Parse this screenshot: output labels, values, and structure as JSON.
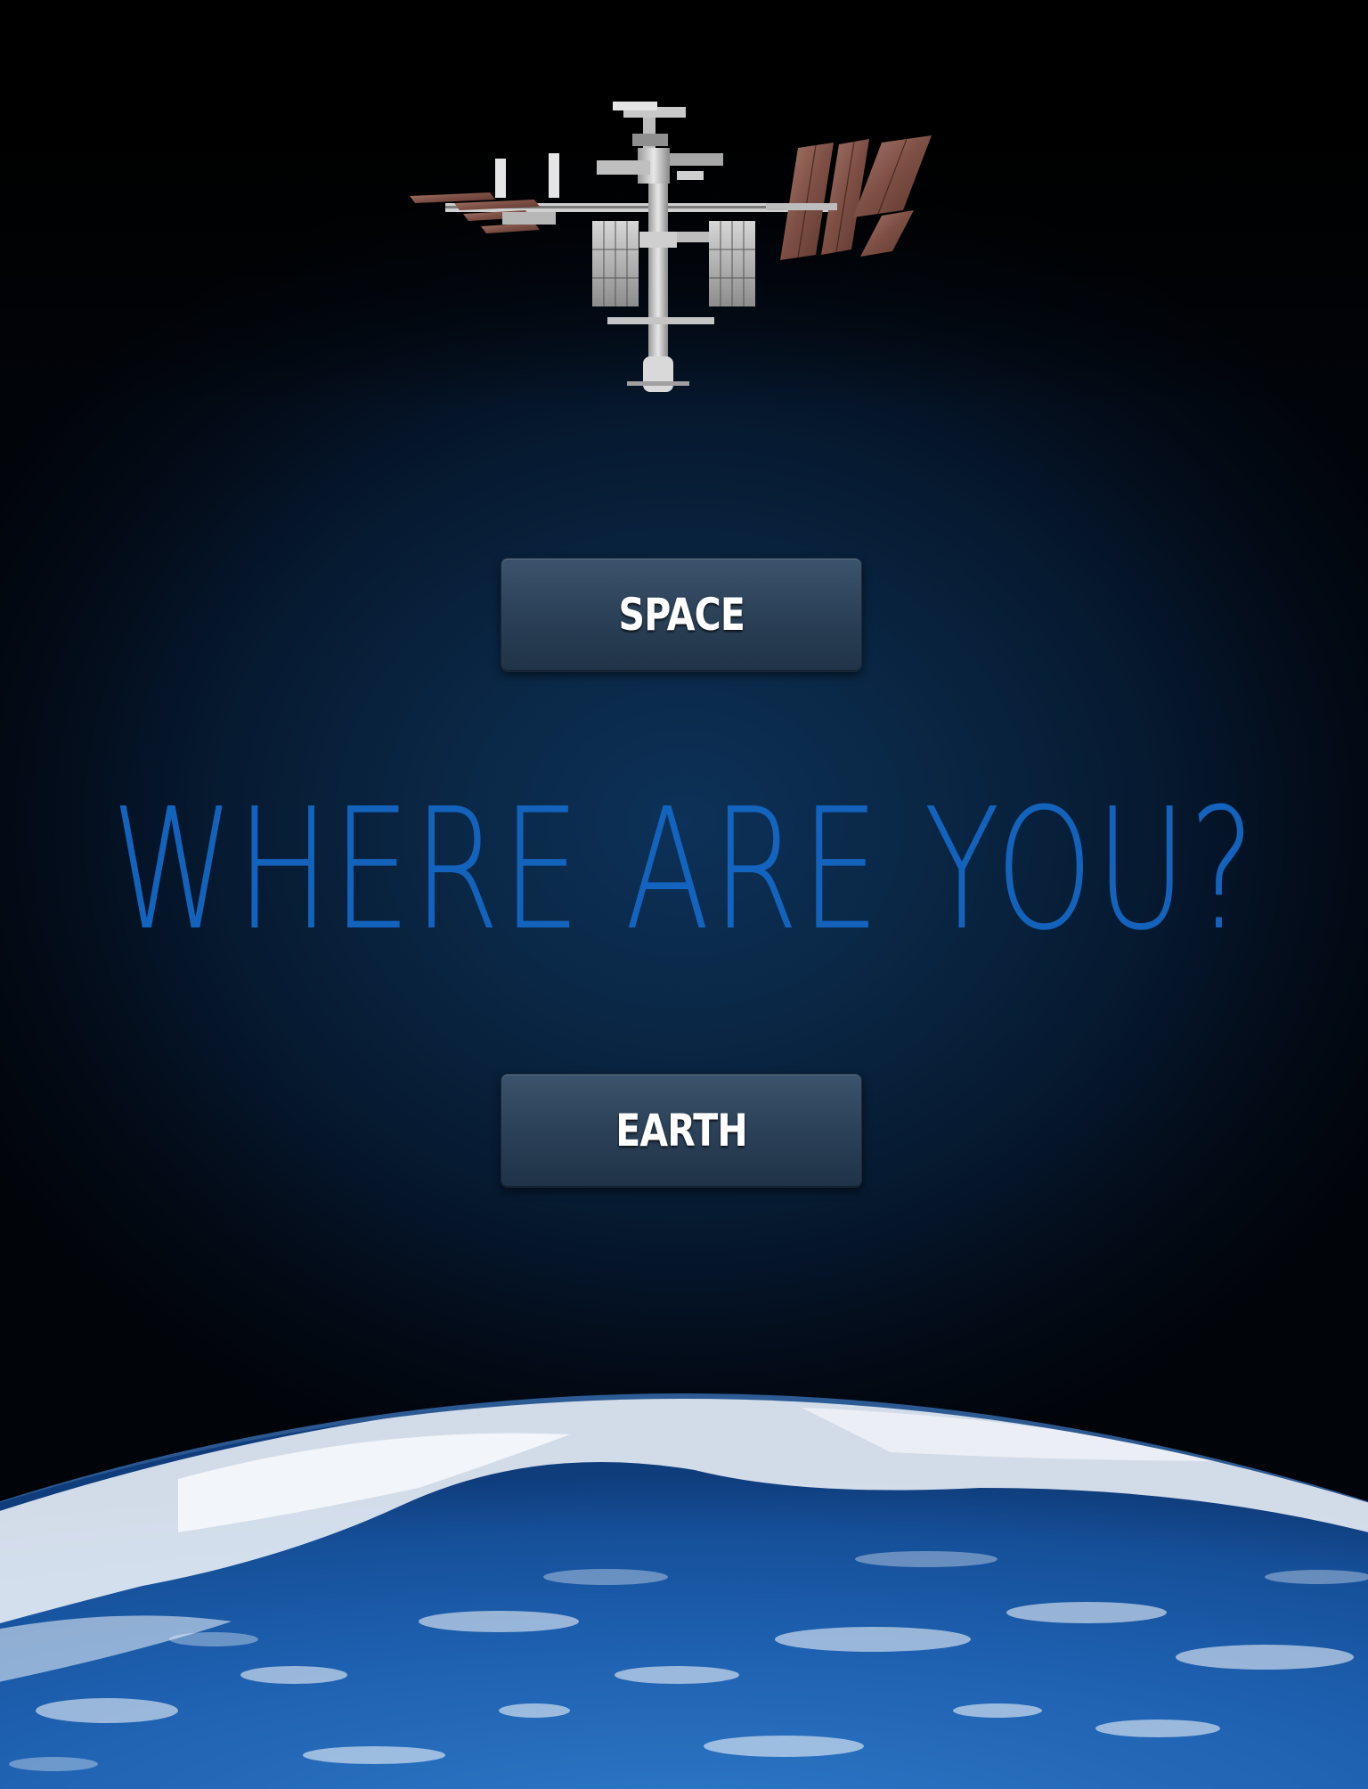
{
  "screen": {
    "headline": "WHERE ARE YOU?",
    "buttons": {
      "space_label": "SPACE",
      "earth_label": "EARTH"
    }
  },
  "images": {
    "station": "space-station-illustration",
    "earth": "earth-horizon-illustration"
  },
  "colors": {
    "headline": "#1467c4",
    "button_top": "#3b536c",
    "button_bottom": "#203347",
    "background_center": "#0d3158",
    "background_edge": "#010409",
    "ocean": "#1d5fae",
    "clouds": "#eef3f8"
  }
}
